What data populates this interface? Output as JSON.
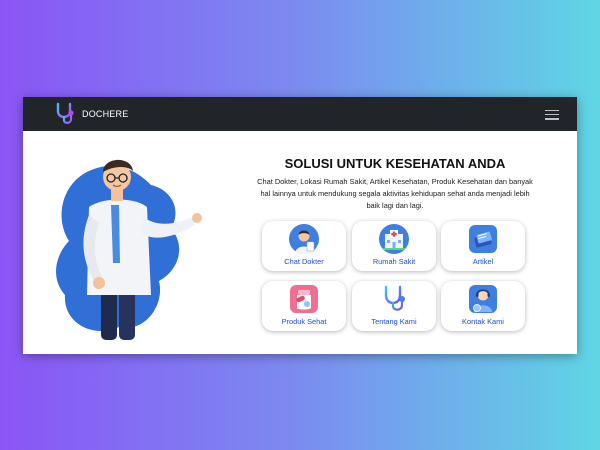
{
  "navbar": {
    "brand": "DOCHERE",
    "logo_icon": "stethoscope-icon",
    "menu_icon": "hamburger-menu-icon"
  },
  "hero": {
    "title": "SOLUSI UNTUK KESEHATAN ANDA",
    "description": "Chat Dokter, Lokasi Rumah Sakit, Artikel Kesehatan, Produk Kesehatan dan banyak hal lainnya untuk mendukung segala aktivitas kehidupan sehat anda menjadi lebih baik lagi dan lagi."
  },
  "services": [
    {
      "label": "Chat Dokter",
      "icon": "doctor-icon"
    },
    {
      "label": "Rumah Sakit",
      "icon": "hospital-icon"
    },
    {
      "label": "Artikel",
      "icon": "article-icon"
    },
    {
      "label": "Produk Sehat",
      "icon": "medicine-icon"
    },
    {
      "label": "Tentang Kami",
      "icon": "stethoscope-icon"
    },
    {
      "label": "Kontak Kami",
      "icon": "contact-icon"
    }
  ],
  "colors": {
    "navbar": "#212529",
    "accent": "#1d4fd8",
    "hero_blob": "#2f6fd6"
  }
}
